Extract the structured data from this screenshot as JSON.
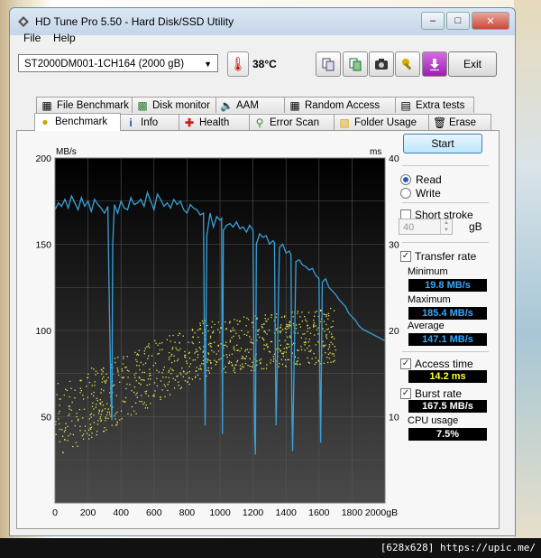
{
  "window": {
    "title": "HD Tune Pro 5.50 - Hard Disk/SSD Utility"
  },
  "menu": {
    "file": "File",
    "help": "Help"
  },
  "toolbar": {
    "drive": "ST2000DM001-1CH164 (2000 gB)",
    "temperature": "38°C",
    "exit_label": "Exit"
  },
  "tabs_top": [
    {
      "label": "File Benchmark",
      "icon": "file-benchmark-icon"
    },
    {
      "label": "Disk monitor",
      "icon": "disk-monitor-icon"
    },
    {
      "label": "AAM",
      "icon": "speaker-icon"
    },
    {
      "label": "Random Access",
      "icon": "random-access-icon"
    },
    {
      "label": "Extra tests",
      "icon": "extra-tests-icon"
    }
  ],
  "tabs_bottom": [
    {
      "label": "Benchmark",
      "icon": "benchmark-icon",
      "active": true
    },
    {
      "label": "Info",
      "icon": "info-icon"
    },
    {
      "label": "Health",
      "icon": "health-icon"
    },
    {
      "label": "Error Scan",
      "icon": "error-scan-icon"
    },
    {
      "label": "Folder Usage",
      "icon": "folder-icon"
    },
    {
      "label": "Erase",
      "icon": "erase-icon"
    }
  ],
  "side": {
    "start_label": "Start",
    "read_label": "Read",
    "write_label": "Write",
    "short_stroke_label": "Short stroke",
    "short_stroke_value": "40",
    "short_stroke_unit": "gB",
    "transfer_rate_label": "Transfer rate",
    "minimum_label": "Minimum",
    "minimum_value": "19.8 MB/s",
    "maximum_label": "Maximum",
    "maximum_value": "185.4 MB/s",
    "average_label": "Average",
    "average_value": "147.1 MB/s",
    "access_time_label": "Access time",
    "access_time_value": "14.2 ms",
    "burst_rate_label": "Burst rate",
    "burst_rate_value": "167.5 MB/s",
    "cpu_usage_label": "CPU usage",
    "cpu_usage_value": "7.5%"
  },
  "colors": {
    "transfer_line": "#3aa0d8",
    "access_dots": "#e6e64a",
    "value_blue": "#33a8ff",
    "value_yellow": "#ffff33",
    "value_white": "#ffffff"
  },
  "chart_data": {
    "type": "line",
    "ylabel_left": "MB/s",
    "ylabel_right": "ms",
    "x_ticks": [
      "0",
      "200",
      "400",
      "600",
      "800",
      "1000",
      "1200",
      "1400",
      "1600",
      "1800",
      "2000gB"
    ],
    "y_left_ticks": [
      "200",
      "150",
      "100",
      "50"
    ],
    "y_right_ticks": [
      "40",
      "30",
      "20",
      "10"
    ],
    "xlim": [
      0,
      2000
    ],
    "ylim_left": [
      0,
      200
    ],
    "ylim_right": [
      0,
      40
    ],
    "series": [
      {
        "axis": "left",
        "x": [
          0,
          20,
          40,
          60,
          80,
          100,
          120,
          140,
          160,
          180,
          200,
          220,
          240,
          260,
          280,
          300,
          320,
          330,
          340,
          345,
          350,
          360,
          380,
          400,
          420,
          440,
          460,
          480,
          500,
          520,
          540,
          560,
          580,
          600,
          620,
          640,
          660,
          680,
          700,
          720,
          740,
          760,
          780,
          800,
          820,
          840,
          860,
          880,
          900,
          905,
          910,
          920,
          940,
          960,
          980,
          1000,
          1010,
          1015,
          1020,
          1040,
          1060,
          1080,
          1100,
          1120,
          1140,
          1160,
          1180,
          1200,
          1210,
          1215,
          1220,
          1240,
          1260,
          1280,
          1300,
          1320,
          1330,
          1335,
          1340,
          1360,
          1380,
          1400,
          1420,
          1430,
          1435,
          1440,
          1460,
          1480,
          1500,
          1520,
          1540,
          1560,
          1580,
          1600,
          1605,
          1610,
          1620,
          1640,
          1660,
          1680,
          1700,
          1720,
          1740,
          1760,
          1780,
          1800,
          1820,
          1840,
          1860,
          1880,
          1900,
          1920,
          1940,
          1960,
          1980,
          2000
        ],
        "y": [
          170,
          174,
          172,
          176,
          171,
          178,
          174,
          170,
          177,
          172,
          175,
          169,
          176,
          173,
          171,
          168,
          172,
          110,
          60,
          48,
          150,
          173,
          168,
          175,
          171,
          170,
          177,
          173,
          174,
          176,
          172,
          180,
          175,
          170,
          179,
          176,
          172,
          174,
          171,
          176,
          173,
          175,
          170,
          168,
          173,
          171,
          170,
          167,
          168,
          100,
          45,
          155,
          168,
          160,
          166,
          164,
          165,
          40,
          158,
          161,
          162,
          160,
          163,
          159,
          160,
          157,
          161,
          158,
          40,
          28,
          150,
          156,
          154,
          155,
          150,
          152,
          151,
          90,
          45,
          148,
          150,
          145,
          146,
          144,
          60,
          30,
          140,
          141,
          138,
          137,
          135,
          136,
          132,
          130,
          75,
          35,
          128,
          130,
          125,
          123,
          121,
          118,
          116,
          114,
          110,
          108,
          106,
          103,
          101,
          100,
          99,
          98,
          97,
          96,
          95,
          94
        ]
      },
      {
        "axis": "right",
        "type": "scatter",
        "note_none": "",
        "x": [],
        "y": []
      }
    ]
  }
}
